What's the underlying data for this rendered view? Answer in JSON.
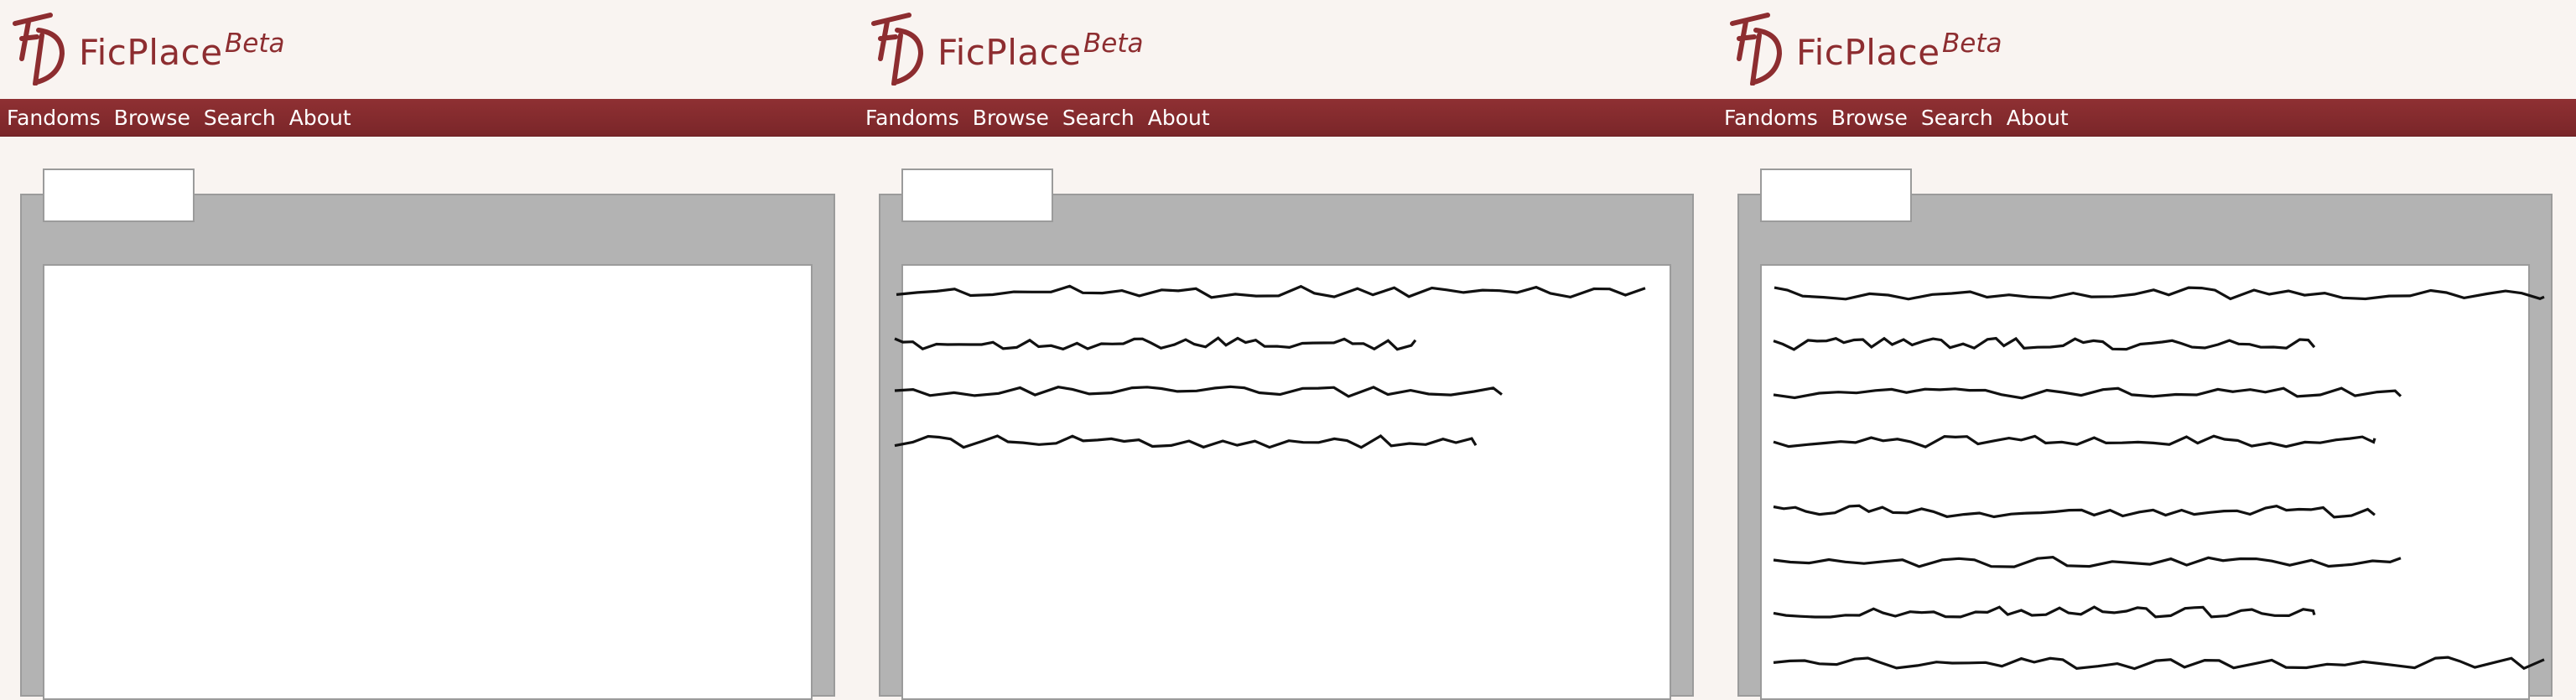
{
  "app": {
    "brand_name": "FicPlace",
    "brand_badge": "Beta",
    "brand_color": "#8d2d30",
    "nav_bar_color": "#83292c"
  },
  "nav": {
    "items": [
      {
        "label": "Fandoms"
      },
      {
        "label": "Browse"
      },
      {
        "label": "Search"
      },
      {
        "label": "About"
      }
    ]
  },
  "frames": [
    {
      "content_state": "empty",
      "placeholder_line_count": 0
    },
    {
      "content_state": "loading-text",
      "placeholder_line_count": 4
    },
    {
      "content_state": "loading-text",
      "placeholder_line_count": 8
    }
  ]
}
